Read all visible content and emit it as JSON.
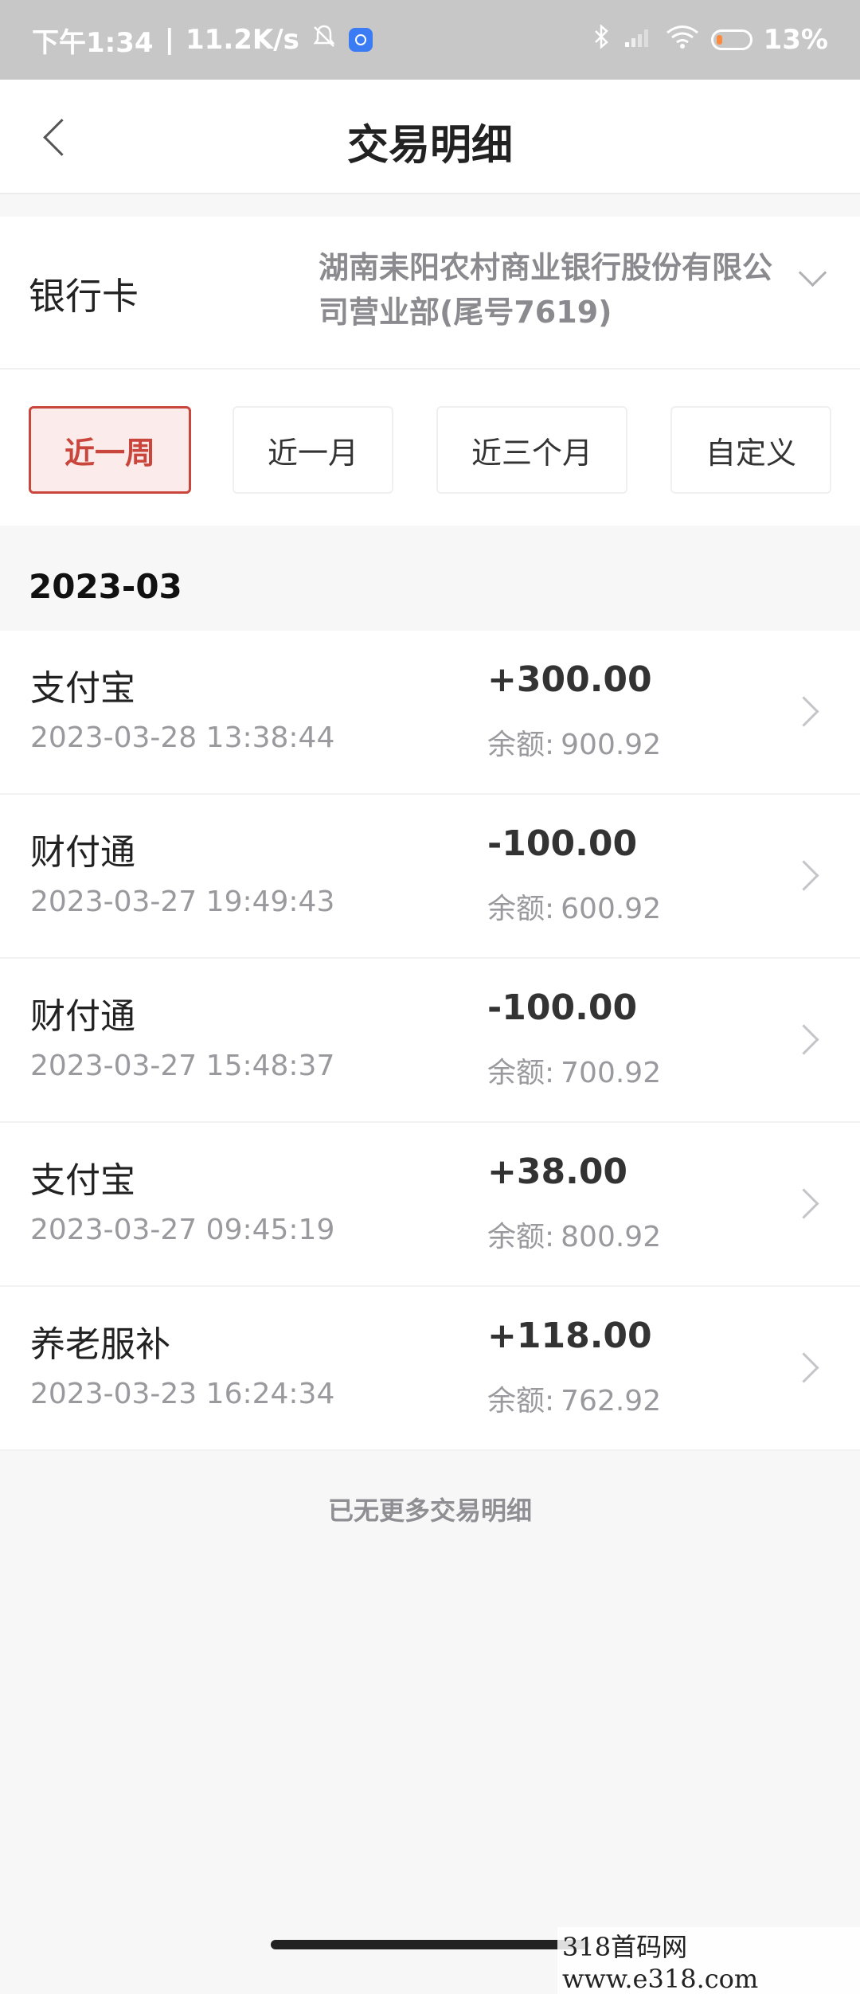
{
  "status_bar": {
    "time": "下午1:34",
    "speed": "11.2K/s",
    "battery": "13%",
    "icons": [
      "bell-off-icon",
      "app-notification-icon",
      "bluetooth-icon",
      "signal-icon",
      "wifi-icon",
      "battery-icon"
    ]
  },
  "header": {
    "title": "交易明细",
    "back_icon": "chevron-left-icon"
  },
  "card": {
    "label": "银行卡",
    "value": "湖南耒阳农村商业银行股份有限公司营业部(尾号7619)",
    "dropdown_icon": "chevron-down-icon"
  },
  "filters": [
    {
      "label": "近一周",
      "active": true
    },
    {
      "label": "近一月",
      "active": false
    },
    {
      "label": "近三个月",
      "active": false
    },
    {
      "label": "自定义",
      "active": false
    }
  ],
  "month": "2023-03",
  "transactions": [
    {
      "name": "支付宝",
      "time": "2023-03-28 13:38:44",
      "amount": "+300.00",
      "balance_label": "余额:",
      "balance": "900.92"
    },
    {
      "name": "财付通",
      "time": "2023-03-27 19:49:43",
      "amount": "-100.00",
      "balance_label": "余额:",
      "balance": "600.92"
    },
    {
      "name": "财付通",
      "time": "2023-03-27 15:48:37",
      "amount": "-100.00",
      "balance_label": "余额:",
      "balance": "700.92"
    },
    {
      "name": "支付宝",
      "time": "2023-03-27 09:45:19",
      "amount": "+38.00",
      "balance_label": "余额:",
      "balance": "800.92"
    },
    {
      "name": "养老服补",
      "time": "2023-03-23 16:24:34",
      "amount": "+118.00",
      "balance_label": "余额:",
      "balance": "762.92"
    }
  ],
  "footer": {
    "no_more": "已无更多交易明细"
  },
  "watermark": "318首码网 www.e318.com",
  "colors": {
    "accent": "#c9463d",
    "accent_bg": "#fbeceb",
    "page_bg": "#f7f7f8",
    "muted_text": "#9a9a9e"
  }
}
